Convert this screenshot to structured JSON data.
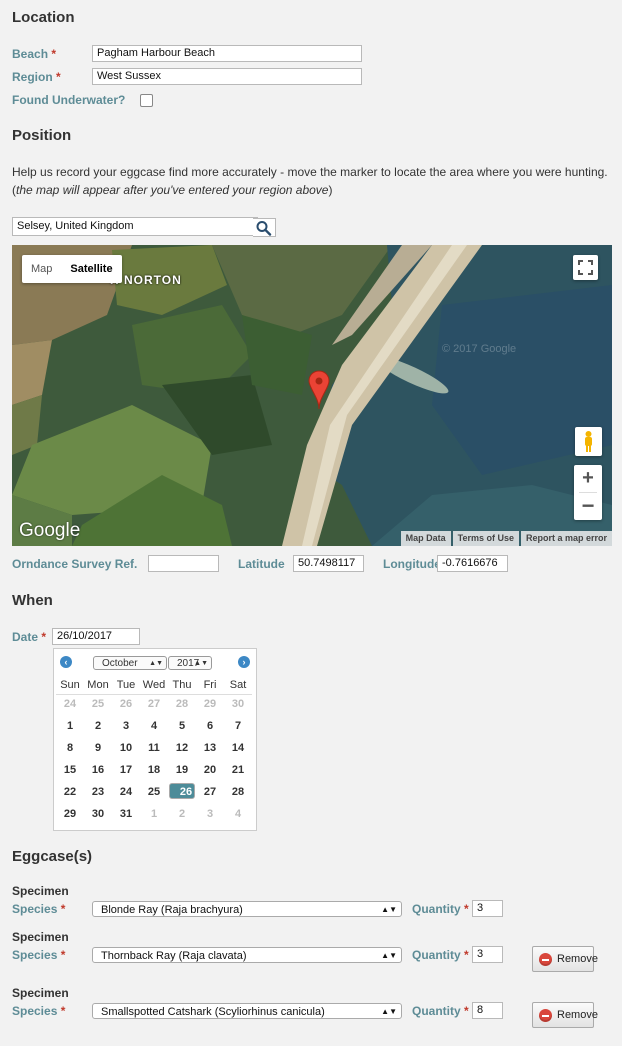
{
  "location": {
    "heading": "Location",
    "beach_label": "Beach",
    "beach_value": "Pagham Harbour Beach",
    "region_label": "Region",
    "region_value": "West Sussex",
    "underwater_label": "Found Underwater?",
    "required_mark": "*"
  },
  "position": {
    "heading": "Position",
    "help_text": "Help us record your eggcase find more accurately - move the marker to locate the area where you were hunting.",
    "note_open": "(",
    "note_italic": "the map will appear after you've entered your region above",
    "note_close": ")",
    "search_value": "Selsey, United Kingdom",
    "map": {
      "type_map": "Map",
      "type_satellite": "Satellite",
      "place_label": "H NORTON",
      "logo": "Google",
      "footer": [
        "Map Data",
        "Terms of Use",
        "Report a map error"
      ],
      "watermark": "© 2017 Google"
    },
    "os_label": "Orndance Survey Ref.",
    "os_value": "",
    "lat_label": "Latitude",
    "lat_value": "50.7498117",
    "lng_label": "Longitude",
    "lng_value": "-0.7616676"
  },
  "when": {
    "heading": "When",
    "date_label": "Date",
    "date_value": "26/10/2017",
    "calendar": {
      "month": "October",
      "year": "2017",
      "weekdays": [
        "Sun",
        "Mon",
        "Tue",
        "Wed",
        "Thu",
        "Fri",
        "Sat"
      ],
      "weeks": [
        [
          "24",
          "25",
          "26",
          "27",
          "28",
          "29",
          "30"
        ],
        [
          "1",
          "2",
          "3",
          "4",
          "5",
          "6",
          "7"
        ],
        [
          "8",
          "9",
          "10",
          "11",
          "12",
          "13",
          "14"
        ],
        [
          "15",
          "16",
          "17",
          "18",
          "19",
          "20",
          "21"
        ],
        [
          "22",
          "23",
          "24",
          "25",
          "26",
          "27",
          "28"
        ],
        [
          "29",
          "30",
          "31",
          "1",
          "2",
          "3",
          "4"
        ]
      ],
      "selected_day": "26"
    }
  },
  "eggcases": {
    "heading": "Eggcase(s)",
    "specimen_label": "Specimen",
    "species_label": "Species",
    "quantity_label": "Quantity",
    "remove_label": "Remove",
    "items": [
      {
        "species": "Blonde Ray (Raja brachyura)",
        "quantity": "3"
      },
      {
        "species": "Thornback Ray (Raja clavata)",
        "quantity": "3"
      },
      {
        "species": "Smallspotted Catshark (Scyliorhinus canicula)",
        "quantity": "8"
      }
    ]
  },
  "colors": {
    "label_teal": "#5e8c96",
    "required_red": "#c0392b",
    "selected_day_bg": "#4d8c99",
    "nav_blue": "#3d88c5"
  }
}
